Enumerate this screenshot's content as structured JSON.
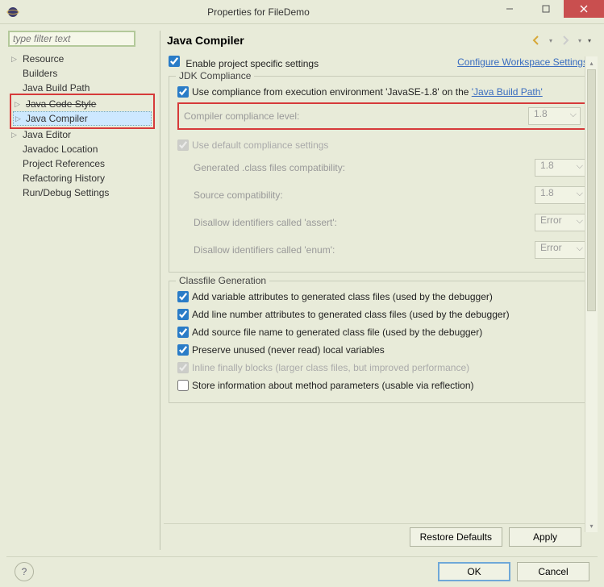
{
  "window": {
    "title": "Properties for FileDemo"
  },
  "filter": {
    "placeholder": "type filter text"
  },
  "sidebar": {
    "items": [
      {
        "label": "Resource",
        "hasChildren": true
      },
      {
        "label": "Builders"
      },
      {
        "label": "Java Build Path"
      },
      {
        "label": "Java Code Style",
        "strike": true,
        "hasChildren": true
      },
      {
        "label": "Java Compiler",
        "selected": true,
        "hasChildren": true
      },
      {
        "label": "Java Editor",
        "hasChildren": true
      },
      {
        "label": "Javadoc Location"
      },
      {
        "label": "Project References"
      },
      {
        "label": "Refactoring History"
      },
      {
        "label": "Run/Debug Settings"
      }
    ]
  },
  "panel": {
    "title": "Java Compiler",
    "enableProject": "Enable project specific settings",
    "configureLink": "Configure Workspace Settings...",
    "jdkCompliance": {
      "title": "JDK Compliance",
      "useFromEnv": "Use compliance from execution environment 'JavaSE-1.8' on the ",
      "buildPathLink": "'Java Build Path'",
      "complianceLevelLabel": "Compiler compliance level:",
      "complianceLevelValue": "1.8",
      "useDefault": "Use default compliance settings",
      "generatedCompatLabel": "Generated .class files compatibility:",
      "generatedCompatValue": "1.8",
      "sourceCompatLabel": "Source compatibility:",
      "sourceCompatValue": "1.8",
      "disallowAssertLabel": "Disallow identifiers called 'assert':",
      "disallowAssertValue": "Error",
      "disallowEnumLabel": "Disallow identifiers called 'enum':",
      "disallowEnumValue": "Error"
    },
    "classfile": {
      "title": "Classfile Generation",
      "addVarAttrs": "Add variable attributes to generated class files (used by the debugger)",
      "addLineAttrs": "Add line number attributes to generated class files (used by the debugger)",
      "addSourceFile": "Add source file name to generated class file (used by the debugger)",
      "preserveUnused": "Preserve unused (never read) local variables",
      "inlineFinally": "Inline finally blocks (larger class files, but improved performance)",
      "storeMethodParams": "Store information about method parameters (usable via reflection)"
    }
  },
  "buttons": {
    "restoreDefaults": "Restore Defaults",
    "apply": "Apply",
    "ok": "OK",
    "cancel": "Cancel"
  }
}
